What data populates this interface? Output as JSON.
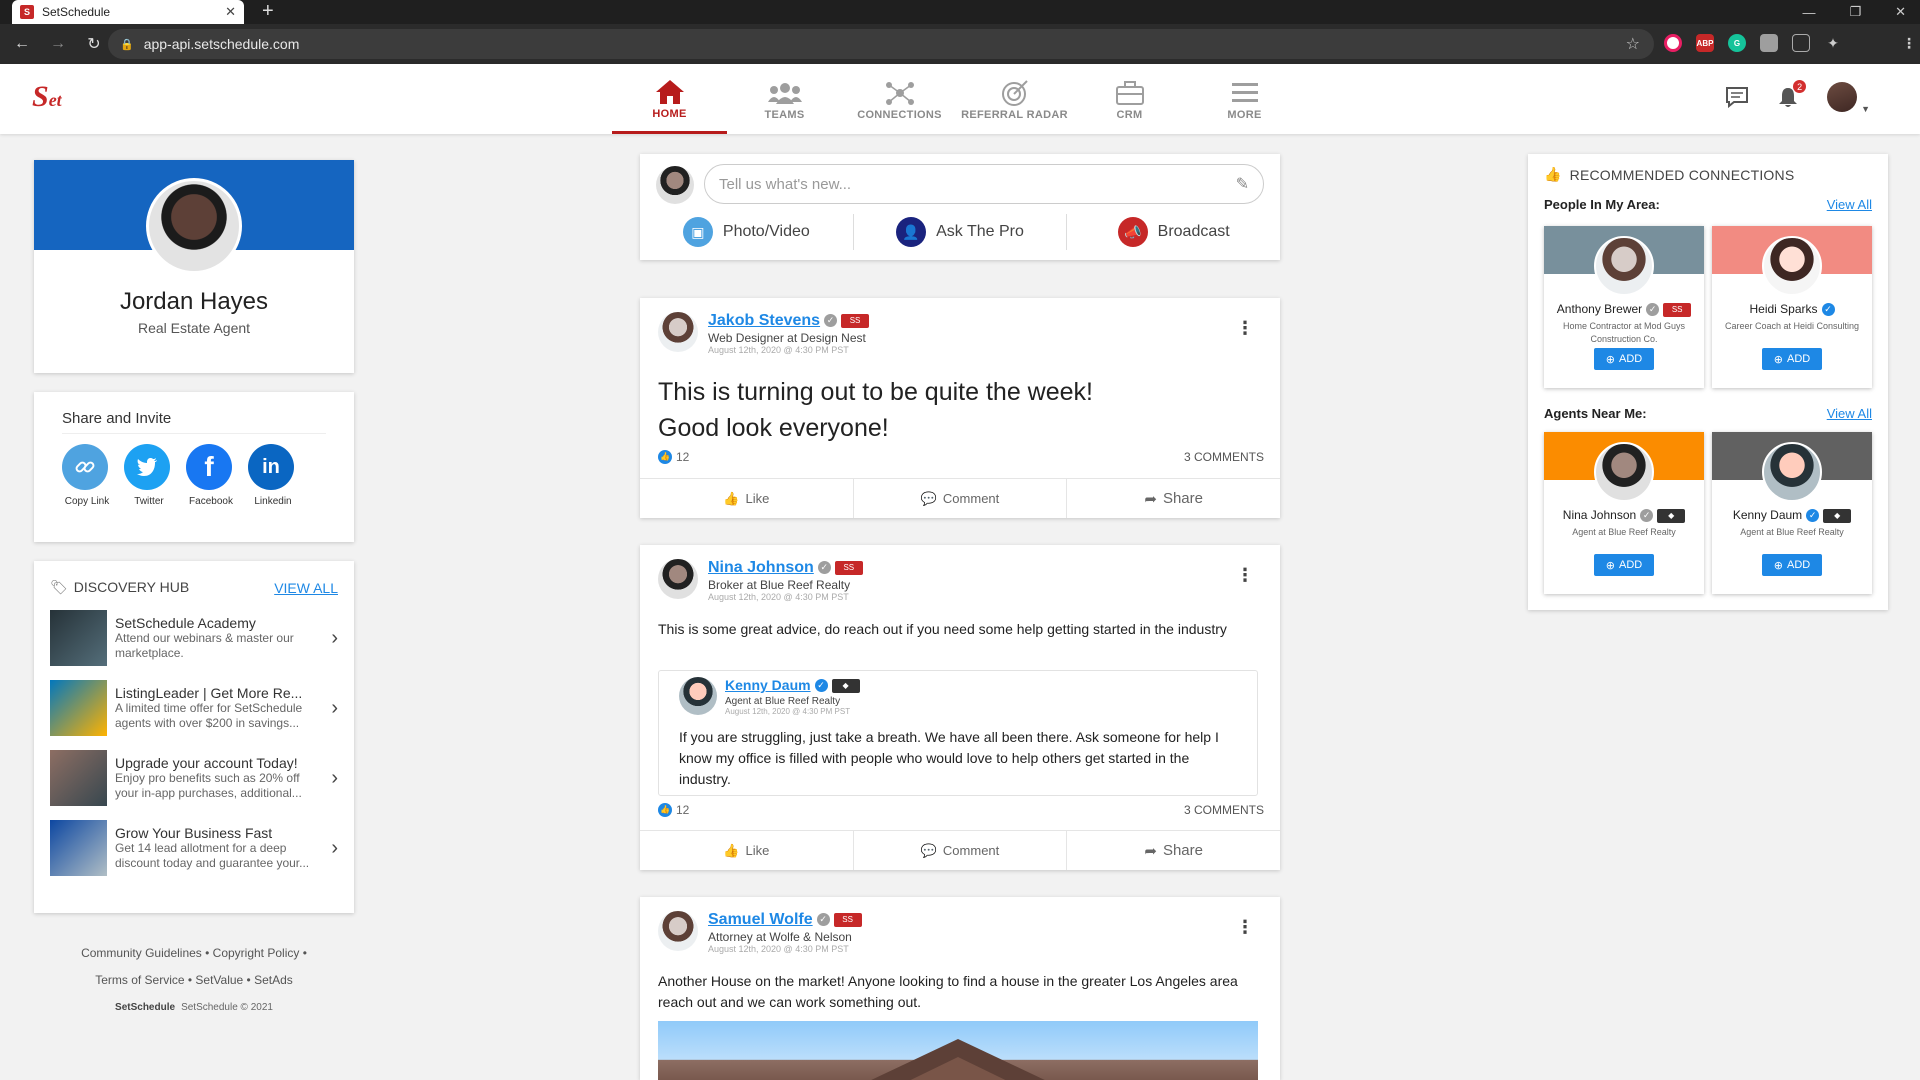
{
  "browser": {
    "tab_title": "SetSchedule",
    "url": "app-api.setschedule.com"
  },
  "nav": {
    "items": [
      {
        "label": "HOME"
      },
      {
        "label": "TEAMS"
      },
      {
        "label": "CONNECTIONS"
      },
      {
        "label": "REFERRAL RADAR"
      },
      {
        "label": "CRM"
      },
      {
        "label": "MORE"
      }
    ],
    "notification_count": "2"
  },
  "profile": {
    "name": "Jordan Hayes",
    "title": "Real Estate Agent"
  },
  "share": {
    "heading": "Share and Invite",
    "items": [
      {
        "label": "Copy Link"
      },
      {
        "label": "Twitter"
      },
      {
        "label": "Facebook"
      },
      {
        "label": "Linkedin"
      }
    ]
  },
  "hub": {
    "heading": "DISCOVERY HUB",
    "view_all": "VIEW ALL",
    "items": [
      {
        "title": "SetSchedule Academy",
        "desc": "Attend our webinars & master our marketplace."
      },
      {
        "title": "ListingLeader | Get More Re...",
        "desc": "A limited time offer for SetSchedule agents with over $200 in savings..."
      },
      {
        "title": "Upgrade your account Today!",
        "desc": "Enjoy pro benefits such as 20% off your in-app purchases, additional..."
      },
      {
        "title": "Grow Your Business Fast",
        "desc": "Get 14 lead allotment for a deep discount today and guarantee your..."
      }
    ]
  },
  "footer": {
    "line1": "Community Guidelines  •  Copyright Policy  •",
    "line2": "Terms of Service  •  SetValue  •  SetAds",
    "brand": "SetSchedule",
    "copyright": "SetSchedule © 2021"
  },
  "composer": {
    "placeholder": "Tell us what's new...",
    "actions": [
      {
        "label": "Photo/Video"
      },
      {
        "label": "Ask The Pro"
      },
      {
        "label": "Broadcast"
      }
    ]
  },
  "post_actions": {
    "like": "Like",
    "comment": "Comment",
    "share": "Share"
  },
  "posts": [
    {
      "author": "Jakob Stevens",
      "role": "Web Designer at Design Nest",
      "date": "August 12th, 2020 @ 4:30 PM PST",
      "body": "This is turning out to be quite the week! Good look everyone!",
      "likes": "12",
      "comments": "3 COMMENTS"
    },
    {
      "author": "Nina Johnson",
      "role": "Broker at Blue Reef Realty",
      "date": "August 12th, 2020 @ 4:30 PM PST",
      "body": "This is some great advice, do reach out if you need some help getting started in the industry",
      "likes": "12",
      "comments": "3 COMMENTS",
      "shared": {
        "author": "Kenny Daum",
        "role": "Agent at Blue Reef Realty",
        "date": "August 12th, 2020 @ 4:30 PM PST",
        "body": "If you are struggling, just take a breath. We have all been there. Ask someone for help I know my office is filled with people who would love to help others get started in the industry."
      }
    },
    {
      "author": "Samuel Wolfe",
      "role": "Attorney at Wolfe & Nelson",
      "date": "August 12th, 2020 @ 4:30 PM PST",
      "body": "Another House on the market! Anyone looking to find a house in the greater Los Angeles area reach out and we can work something out."
    }
  ],
  "recommended": {
    "heading": "RECOMMENDED CONNECTIONS",
    "area_label": "People In My Area:",
    "agents_label": "Agents Near Me:",
    "view_all": "View All",
    "add_label": "ADD",
    "people": [
      {
        "name": "Anthony Brewer",
        "desc": "Home Contractor at Mod Guys Construction Co.",
        "color": "#78909c"
      },
      {
        "name": "Heidi Sparks",
        "desc": "Career Coach at Heidi Consulting",
        "color": "#f28b82"
      },
      {
        "name": "Nina Johnson",
        "desc": "Agent at Blue Reef Realty",
        "color": "#fb8c00"
      },
      {
        "name": "Kenny Daum",
        "desc": "Agent at Blue Reef Realty",
        "color": "#616161"
      }
    ]
  },
  "colors": {
    "brand_red": "#b71c1c",
    "link_blue": "#1e88e5",
    "profile_banner": "#1565c0"
  }
}
